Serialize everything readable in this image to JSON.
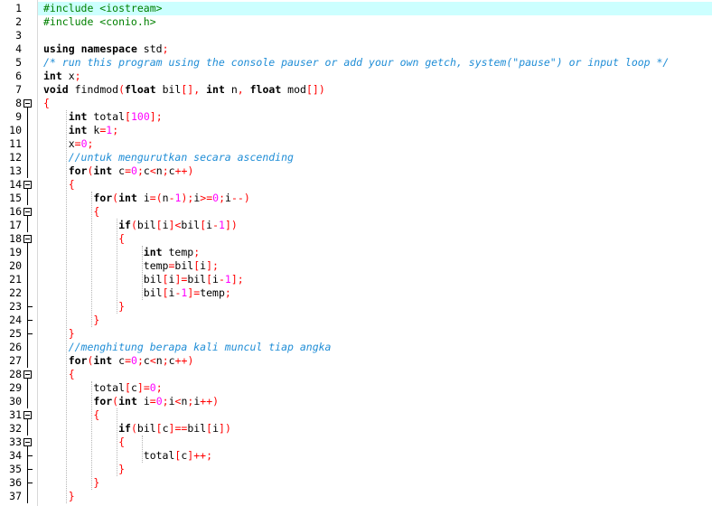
{
  "editor": {
    "current_line": 1,
    "lines": [
      "#include <iostream>",
      "#include <conio.h>",
      "",
      "using namespace std;",
      "/* run this program using the console pauser or add your own getch, system(\"pause\") or input loop */",
      "int x;",
      "void findmod(float bil[], int n, float mod[])",
      "{",
      "    int total[100];",
      "    int k=1;",
      "    x=0;",
      "    //untuk mengurutkan secara ascending",
      "    for(int c=0;c<n;c++)",
      "    {",
      "        for(int i=(n-1);i>=0;i--)",
      "        {",
      "            if(bil[i]<bil[i-1])",
      "            {",
      "                int temp;",
      "                temp=bil[i];",
      "                bil[i]=bil[i-1];",
      "                bil[i-1]=temp;",
      "            }",
      "        }",
      "    }",
      "    //menghitung berapa kali muncul tiap angka",
      "    for(int c=0;c<n;c++)",
      "    {",
      "        total[c]=0;",
      "        for(int i=0;i<n;i++)",
      "        {",
      "            if(bil[c]==bil[i])",
      "            {",
      "                total[c]++;",
      "            }",
      "        }",
      "    }"
    ],
    "fold_starts": [
      8,
      14,
      16,
      18,
      28,
      31,
      33
    ],
    "fold_ends": [
      23,
      24,
      25,
      34,
      35,
      36
    ],
    "colors": {
      "keyword": "#000000",
      "preprocessor": "#008000",
      "comment": "#1f8dd6",
      "number": "#ff00ff",
      "symbol": "#ff0000",
      "string": "#0000ff",
      "current_line_bg": "#ccffff"
    }
  }
}
